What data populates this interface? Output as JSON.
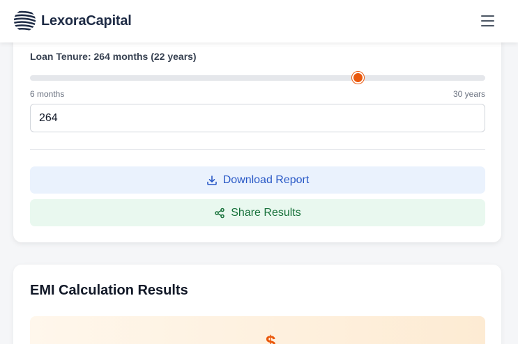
{
  "header": {
    "brand": "LexoraCapital",
    "logo_icon": "globe-stripes-icon",
    "menu_icon": "hamburger-menu-icon"
  },
  "tenure": {
    "label": "Loan Tenure: 264 months (22 years)",
    "min_label": "6 months",
    "max_label": "30 years",
    "value": "264",
    "slider_fraction": 0.72
  },
  "actions": {
    "download_label": "Download Report",
    "download_icon": "download-icon",
    "share_label": "Share Results",
    "share_icon": "share-icon"
  },
  "results": {
    "title": "EMI Calculation Results",
    "currency_symbol": "$"
  },
  "colors": {
    "accent": "#ea580c",
    "download": "#2858c6",
    "share": "#17713a",
    "brand": "#1e2b45"
  }
}
